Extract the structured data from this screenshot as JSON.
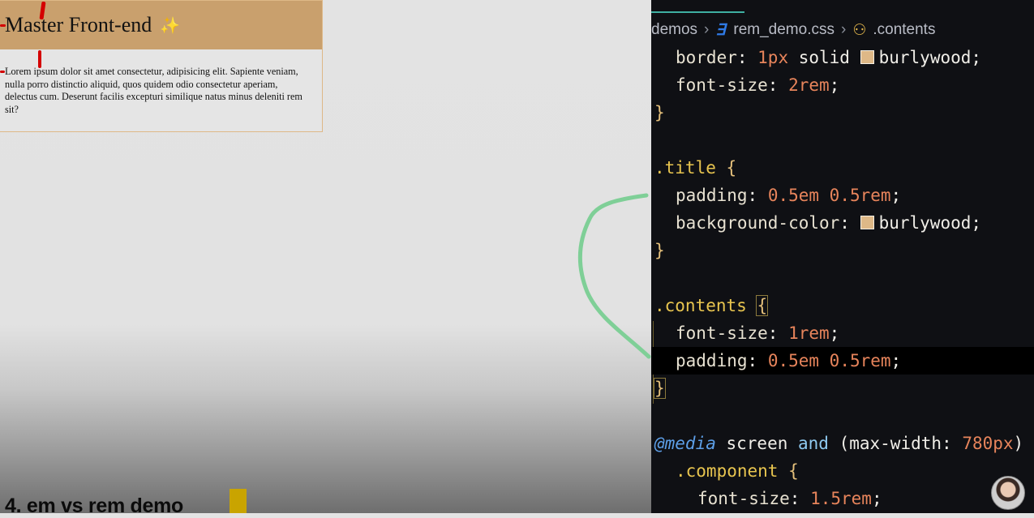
{
  "preview": {
    "title": "Master Front-end",
    "title_emoji": "✨",
    "contents": "Lorem ipsum dolor sit amet consectetur, adipisicing elit. Sapiente veniam, nulla porro distinctio aliquid, quos quidem odio consectetur aperiam, delectus cum. Deserunt facilis excepturi similique natus minus deleniti rem sit?",
    "caption": "4. em vs rem demo"
  },
  "editor": {
    "breadcrumb": {
      "folder": "demos",
      "file_icon": "css-icon",
      "file": "rem_demo.css",
      "symbol_icon": "symbol-class-icon",
      "symbol": ".contents"
    },
    "colors": {
      "burlywood": "#deb887",
      "number": "#e7845b",
      "selector": "#e8c54f"
    },
    "code": {
      "l1": {
        "prop": "border",
        "colon": ": ",
        "num": "1px",
        "rest": " solid ",
        "color": "burlywood",
        "end": ";"
      },
      "l2": {
        "prop": "font-size",
        "colon": ": ",
        "num": "2rem",
        "end": ";"
      },
      "l3": "}",
      "l5": {
        "selector": ".title",
        "brace": " {"
      },
      "l6": {
        "prop": "padding",
        "colon": ": ",
        "num": "0.5em 0.5rem",
        "end": ";"
      },
      "l7": {
        "prop": "background-color",
        "colon": ": ",
        "color": "burlywood",
        "end": ";"
      },
      "l8": "}",
      "l10": {
        "selector": ".contents",
        "brace": "{"
      },
      "l11": {
        "prop": "font-size",
        "colon": ": ",
        "num": "1rem",
        "end": ";"
      },
      "l12": {
        "prop": "padding",
        "colon": ": ",
        "num": "0.5em 0.5rem",
        "end": ";"
      },
      "l13": "}",
      "l15": {
        "at": "@media",
        "rest1": " screen ",
        "kw": "and",
        "rest2": " (max-width: ",
        "num": "780px",
        "end": ") {"
      },
      "l16": {
        "selector": ".component",
        "brace": " {"
      },
      "l17": {
        "prop": "font-size",
        "colon": ": ",
        "num": "1.5rem",
        "end": ";"
      }
    }
  }
}
